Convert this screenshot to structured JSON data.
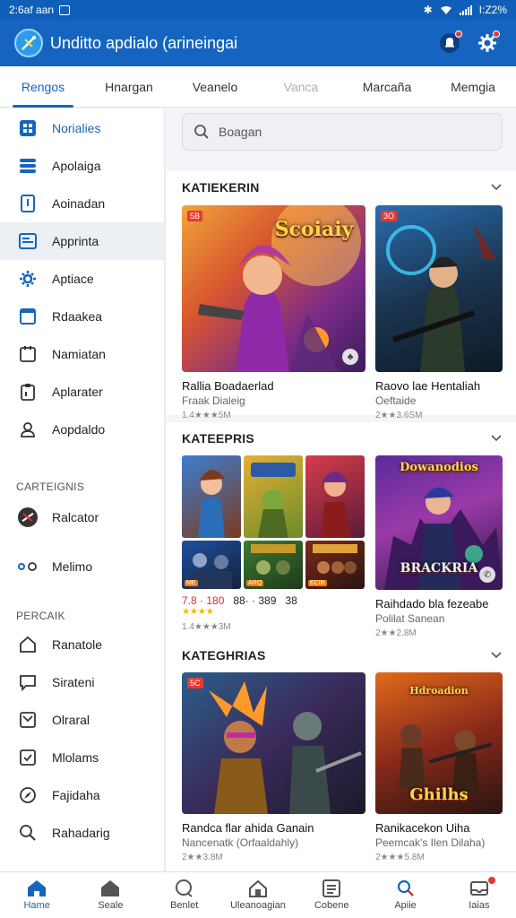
{
  "status_bar": {
    "time": "2:6af aan",
    "battery": "I:Z2%"
  },
  "header": {
    "title": "Unditto apdialo (arineingai"
  },
  "tabs": [
    {
      "label": "Rengos",
      "state": "active"
    },
    {
      "label": "Hnargan",
      "state": "normal"
    },
    {
      "label": "Veanelo",
      "state": "normal"
    },
    {
      "label": "Vanca",
      "state": "muted"
    },
    {
      "label": "Marcaña",
      "state": "normal"
    },
    {
      "label": "Memgia",
      "state": "normal"
    }
  ],
  "sidebar": {
    "items": [
      {
        "label": "Norialies",
        "icon": "grid-icon",
        "active": true
      },
      {
        "label": "Apolaiga",
        "icon": "stack-icon"
      },
      {
        "label": "Aoinadan",
        "icon": "document-icon"
      },
      {
        "label": "Apprinta",
        "icon": "monitor-icon",
        "highlighted": true
      },
      {
        "label": "Aptiace",
        "icon": "gear-icon"
      },
      {
        "label": "Rdaakea",
        "icon": "browser-icon"
      },
      {
        "label": "Namiatan",
        "icon": "calendar-icon"
      },
      {
        "label": "Aplarater",
        "icon": "clipboard-icon"
      },
      {
        "label": "Aopdaldo",
        "icon": "user-gear-icon"
      }
    ],
    "section_categories": "CARTEIGNIS",
    "category_items": [
      {
        "label": "Ralcator",
        "icon": "game-controller-icon"
      },
      {
        "label": "Melimo",
        "icon": "toggle-icon"
      }
    ],
    "section_other": "PERCAIK",
    "other_items": [
      {
        "label": "Ranatole",
        "icon": "home-icon"
      },
      {
        "label": "Sirateni",
        "icon": "chat-icon"
      },
      {
        "label": "Olraral",
        "icon": "image-icon"
      },
      {
        "label": "Mlolams",
        "icon": "checklist-icon"
      },
      {
        "label": "Fajidaha",
        "icon": "compass-icon"
      },
      {
        "label": "Rahadarig",
        "icon": "search-icon"
      }
    ]
  },
  "search": {
    "placeholder": "Boagan"
  },
  "sections": [
    {
      "title": "KATIEKERIN",
      "cards": [
        {
          "title": "Rallia Boadaerlad",
          "subtitle": "Fraak Dialeig",
          "meta": "1.4★★★5M",
          "tag": "5B",
          "art_text": "Scoiaiy",
          "badge": "♣"
        },
        {
          "title": "Raovo lae Hentaliah",
          "subtitle": "Oeftaide",
          "meta": "2★★3.6SM",
          "tag": "3O"
        }
      ]
    },
    {
      "title": "KATEEPRIS",
      "grid": {
        "price_red": "7.8 · 180",
        "price_1": "88· · 389",
        "price_2": "38",
        "stars": "★★★★",
        "meta": "1.4★★★3M",
        "tags": [
          "ME",
          "ARQ",
          "ECIR"
        ]
      },
      "cards": [
        {
          "title": "Raihdado bla fezeabe",
          "subtitle": "Polilat Sanean",
          "meta": "2★★2.8M",
          "art_text": "Dowanodios",
          "art_text2": "BRACKRIA",
          "badge": "✆"
        }
      ]
    },
    {
      "title": "KATEGHRIAS",
      "cards": [
        {
          "title": "Randca flar ahida Ganain",
          "subtitle": "Nancenatk (Orfaaldahly)",
          "meta": "2★★3.8M",
          "tag": "5C"
        },
        {
          "title": "Ranikacekon Uiha",
          "subtitle": "Peemcak's Ilen Dilaha)",
          "meta": "2★★★5.8M",
          "art_text": "Ghilhs",
          "art_text_top": "Hdroadion"
        }
      ]
    }
  ],
  "bottom_nav": [
    {
      "label": "Hame",
      "icon": "home-icon",
      "active": true
    },
    {
      "label": "Seale",
      "icon": "store-icon"
    },
    {
      "label": "Benlet",
      "icon": "chat-search-icon"
    },
    {
      "label": "Uleanoagian",
      "icon": "house-outline-icon"
    },
    {
      "label": "Cobene",
      "icon": "list-icon"
    },
    {
      "label": "Apiie",
      "icon": "search-icon"
    },
    {
      "label": "Iaias",
      "icon": "inbox-icon",
      "badge": true
    }
  ]
}
